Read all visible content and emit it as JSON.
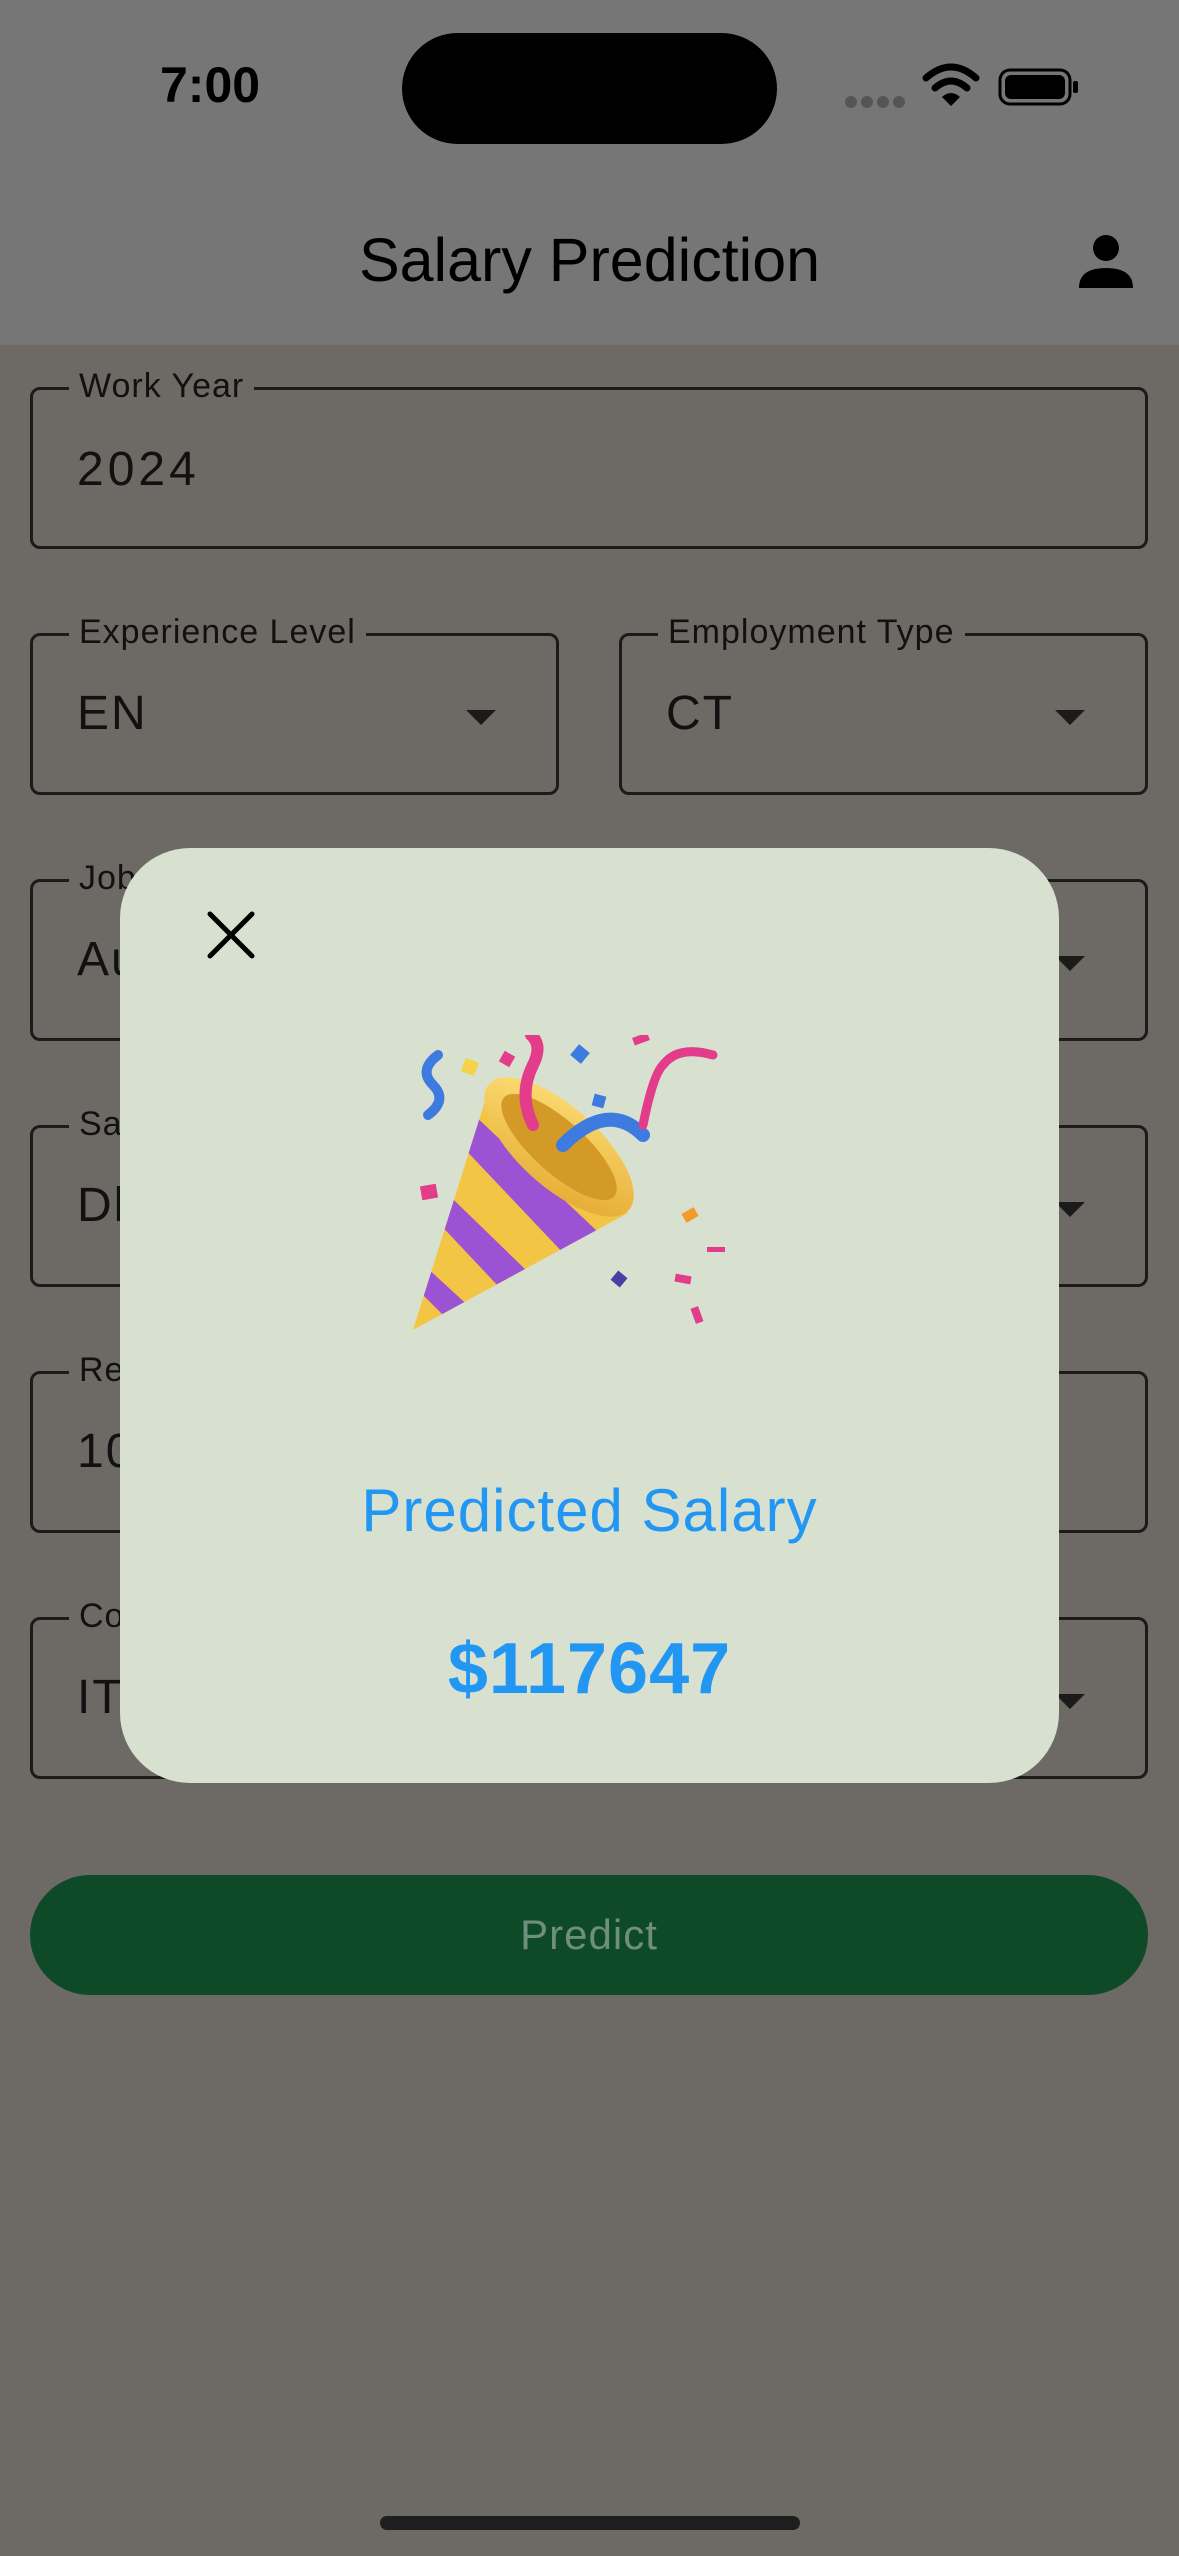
{
  "status_bar": {
    "time": "7:00"
  },
  "header": {
    "title": "Salary Prediction",
    "profile_icon": "person-icon"
  },
  "form": {
    "work_year": {
      "label": "Work Year",
      "value": "2024"
    },
    "experience_level": {
      "label": "Experience Level",
      "value": "EN"
    },
    "employment_type": {
      "label": "Employment Type",
      "value": "CT"
    },
    "job_title": {
      "label_visible": "Job",
      "value_visible": "Au"
    },
    "salary_currency": {
      "label_visible": "Sa",
      "value_visible": "Dl"
    },
    "remote_ratio": {
      "label_visible": "Re",
      "value_visible": "10"
    },
    "company_location": {
      "label_visible": "Co",
      "value_visible": "IT"
    },
    "predict_label": "Predict"
  },
  "modal": {
    "close_icon": "close-icon",
    "illustration_icon": "party-popper-icon",
    "title": "Predicted Salary",
    "value": "$117647"
  },
  "colors": {
    "accent_blue": "#2196f3",
    "predict_button": "#0f4a28",
    "modal_bg": "#d8e1d0",
    "overlay_bg": "#6d6a65"
  }
}
